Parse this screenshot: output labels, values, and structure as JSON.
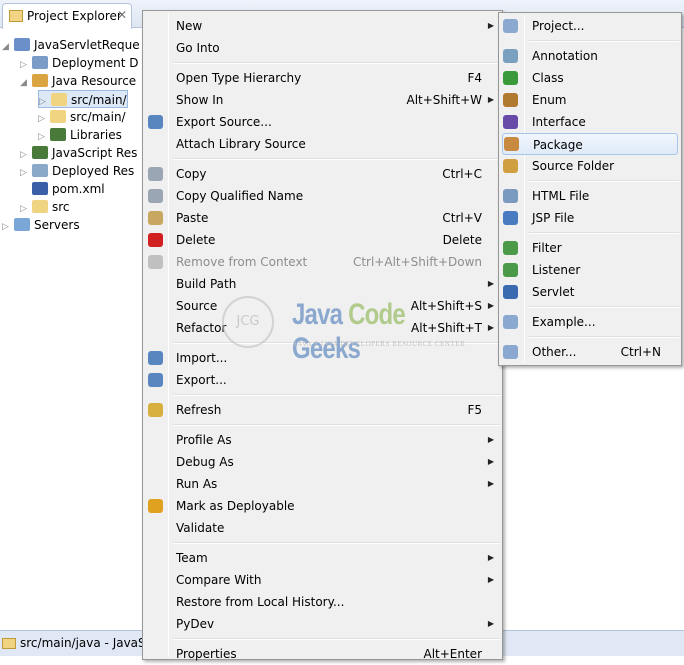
{
  "explorer": {
    "tab_title": "Project Explorer",
    "tree": [
      {
        "label": "JavaServletReque",
        "level": 0,
        "expanded": true,
        "icon": "web-project-icon"
      },
      {
        "label": "Deployment D",
        "level": 1,
        "expanded": false,
        "icon": "deployment-descriptor-icon"
      },
      {
        "label": "Java Resource",
        "level": 1,
        "expanded": true,
        "icon": "java-resources-icon"
      },
      {
        "label": "src/main/",
        "level": 2,
        "expanded": false,
        "icon": "source-folder-icon",
        "selected": true
      },
      {
        "label": "src/main/",
        "level": 2,
        "expanded": false,
        "icon": "source-folder-icon"
      },
      {
        "label": "Libraries",
        "level": 2,
        "expanded": false,
        "icon": "libraries-icon"
      },
      {
        "label": "JavaScript Res",
        "level": 1,
        "expanded": false,
        "icon": "libraries-icon"
      },
      {
        "label": "Deployed Res",
        "level": 1,
        "expanded": false,
        "icon": "deployed-resources-icon"
      },
      {
        "label": "pom.xml",
        "level": 1,
        "leaf": true,
        "icon": "maven-file-icon"
      },
      {
        "label": "src",
        "level": 1,
        "expanded": false,
        "icon": "folder-icon"
      },
      {
        "label": "Servers",
        "level": 0,
        "expanded": false,
        "icon": "servers-folder-icon"
      }
    ]
  },
  "status": {
    "text": "src/main/java - JavaSer"
  },
  "context_menu": [
    {
      "label": "New",
      "submenu": true
    },
    {
      "label": "Go Into"
    },
    {
      "sep": true
    },
    {
      "label": "Open Type Hierarchy",
      "shortcut": "F4"
    },
    {
      "label": "Show In",
      "shortcut": "Alt+Shift+W",
      "submenu": true
    },
    {
      "label": "Export Source...",
      "icon": "export-source-icon"
    },
    {
      "label": "Attach Library Source"
    },
    {
      "sep": true
    },
    {
      "label": "Copy",
      "shortcut": "Ctrl+C",
      "icon": "copy-icon"
    },
    {
      "label": "Copy Qualified Name",
      "icon": "copy-qualified-icon"
    },
    {
      "label": "Paste",
      "shortcut": "Ctrl+V",
      "icon": "paste-icon"
    },
    {
      "label": "Delete",
      "shortcut": "Delete",
      "icon": "delete-icon"
    },
    {
      "label": "Remove from Context",
      "shortcut": "Ctrl+Alt+Shift+Down",
      "disabled": true,
      "icon": "remove-context-icon"
    },
    {
      "label": "Build Path",
      "submenu": true
    },
    {
      "label": "Source",
      "shortcut": "Alt+Shift+S",
      "submenu": true
    },
    {
      "label": "Refactor",
      "shortcut": "Alt+Shift+T",
      "submenu": true
    },
    {
      "sep": true
    },
    {
      "label": "Import...",
      "icon": "import-icon"
    },
    {
      "label": "Export...",
      "icon": "export-icon"
    },
    {
      "sep": true
    },
    {
      "label": "Refresh",
      "shortcut": "F5",
      "icon": "refresh-icon"
    },
    {
      "sep": true
    },
    {
      "label": "Profile As",
      "submenu": true
    },
    {
      "label": "Debug As",
      "submenu": true
    },
    {
      "label": "Run As",
      "submenu": true
    },
    {
      "label": "Mark as Deployable",
      "icon": "deployable-icon"
    },
    {
      "label": "Validate"
    },
    {
      "sep": true
    },
    {
      "label": "Team",
      "submenu": true
    },
    {
      "label": "Compare With",
      "submenu": true
    },
    {
      "label": "Restore from Local History..."
    },
    {
      "label": "PyDev",
      "submenu": true
    },
    {
      "sep": true
    },
    {
      "label": "Properties",
      "shortcut": "Alt+Enter"
    }
  ],
  "new_submenu": [
    {
      "label": "Project...",
      "icon": "new-project-icon"
    },
    {
      "sep": true
    },
    {
      "label": "Annotation",
      "icon": "new-annotation-icon"
    },
    {
      "label": "Class",
      "icon": "new-class-icon"
    },
    {
      "label": "Enum",
      "icon": "new-enum-icon"
    },
    {
      "label": "Interface",
      "icon": "new-interface-icon"
    },
    {
      "label": "Package",
      "icon": "new-package-icon",
      "highlighted": true
    },
    {
      "label": "Source Folder",
      "icon": "new-source-folder-icon"
    },
    {
      "sep": true
    },
    {
      "label": "HTML File",
      "icon": "new-html-file-icon"
    },
    {
      "label": "JSP File",
      "icon": "new-jsp-file-icon"
    },
    {
      "sep": true
    },
    {
      "label": "Filter",
      "icon": "new-filter-icon"
    },
    {
      "label": "Listener",
      "icon": "new-listener-icon"
    },
    {
      "label": "Servlet",
      "icon": "new-servlet-icon"
    },
    {
      "sep": true
    },
    {
      "label": "Example...",
      "icon": "new-example-icon"
    },
    {
      "sep": true
    },
    {
      "label": "Other...",
      "shortcut": "Ctrl+N",
      "icon": "new-other-icon"
    }
  ],
  "watermark": {
    "logo": "JCG",
    "brand_a": "Java ",
    "brand_b": "Code ",
    "brand_c": "Geeks",
    "tagline": "JAVA 2 JAVA DEVELOPERS RESOURCE CENTER"
  },
  "icon_colors": {
    "web-project-icon": "#6b8fc8",
    "deployment-descriptor-icon": "#7a9cc6",
    "java-resources-icon": "#d9a441",
    "source-folder-icon": "#f1d482",
    "libraries-icon": "#4a7a3a",
    "deployed-resources-icon": "#8aa8c8",
    "maven-file-icon": "#3a5fa8",
    "folder-icon": "#f1d482",
    "servers-folder-icon": "#7ba7d8",
    "export-source-icon": "#5a86c0",
    "copy-icon": "#9aa6b4",
    "copy-qualified-icon": "#9aa6b4",
    "paste-icon": "#c8a860",
    "delete-icon": "#d02020",
    "remove-context-icon": "#c0c0c0",
    "import-icon": "#5a86c0",
    "export-icon": "#5a86c0",
    "refresh-icon": "#d8b040",
    "deployable-icon": "#e0a020",
    "new-project-icon": "#8aa8d0",
    "new-annotation-icon": "#7aa0c0",
    "new-class-icon": "#3a9a3a",
    "new-enum-icon": "#b07a30",
    "new-interface-icon": "#6a4aa8",
    "new-package-icon": "#c88a40",
    "new-source-folder-icon": "#d0a040",
    "new-html-file-icon": "#7a9ac0",
    "new-jsp-file-icon": "#4a7ac0",
    "new-filter-icon": "#4a9a4a",
    "new-listener-icon": "#4a9a4a",
    "new-servlet-icon": "#3a6ab0",
    "new-example-icon": "#8aa8d0",
    "new-other-icon": "#8aa8d0"
  }
}
